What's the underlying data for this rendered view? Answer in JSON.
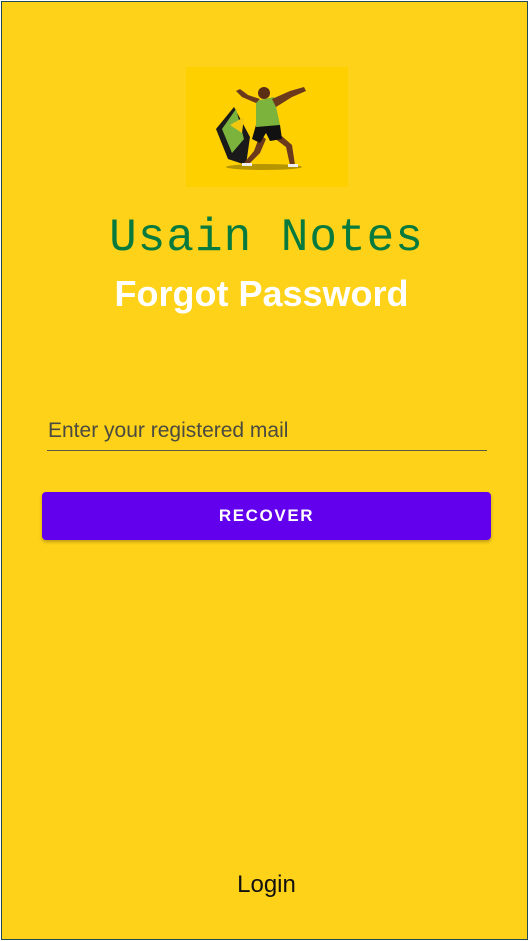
{
  "app": {
    "name": "Usain Notes",
    "logo_icon": "sprinter-lightning-pose-icon"
  },
  "screen": {
    "title": "Forgot Password"
  },
  "form": {
    "email_placeholder": "Enter your registered mail",
    "email_value": "",
    "recover_label": "RECOVER"
  },
  "footer": {
    "login_label": "Login"
  },
  "colors": {
    "background": "#FED219",
    "logo_background": "#FFD000",
    "app_name": "#087A3E",
    "title": "#FFFFFF",
    "button": "#6200EE",
    "button_text": "#FFFFFF"
  }
}
